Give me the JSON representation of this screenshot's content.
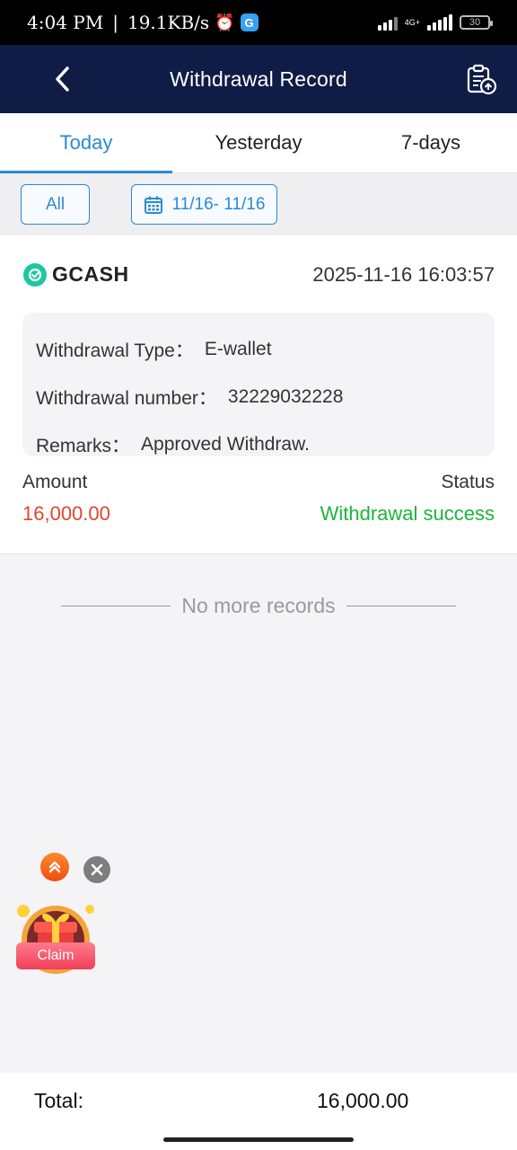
{
  "status_bar": {
    "time": "4:04 PM",
    "separator": "|",
    "speed": "19.1KB/s",
    "network": "4G+",
    "battery": "30"
  },
  "header": {
    "title": "Withdrawal Record"
  },
  "tabs": [
    {
      "label": "Today",
      "active": true
    },
    {
      "label": "Yesterday",
      "active": false
    },
    {
      "label": "7-days",
      "active": false
    }
  ],
  "filters": {
    "all_label": "All",
    "date_range": "11/16- 11/16"
  },
  "record": {
    "provider": "GCASH",
    "datetime": "2025-11-16 16:03:57",
    "type_label": "Withdrawal Type：",
    "type_value": "E-wallet",
    "number_label": "Withdrawal number：",
    "number_value": "32229032228",
    "remarks_label": "Remarks：",
    "remarks_value": "Approved Withdraw.",
    "amount_label": "Amount",
    "amount_value": "16,000.00",
    "status_label": "Status",
    "status_value": "Withdrawal success"
  },
  "list_end": "No more records",
  "promo": {
    "claim_label": "Claim"
  },
  "footer": {
    "total_label": "Total:",
    "total_value": "16,000.00"
  },
  "colors": {
    "header_bg": "#0f1c46",
    "accent": "#2a8ad4",
    "amount": "#e0462e",
    "success": "#1db43a"
  }
}
